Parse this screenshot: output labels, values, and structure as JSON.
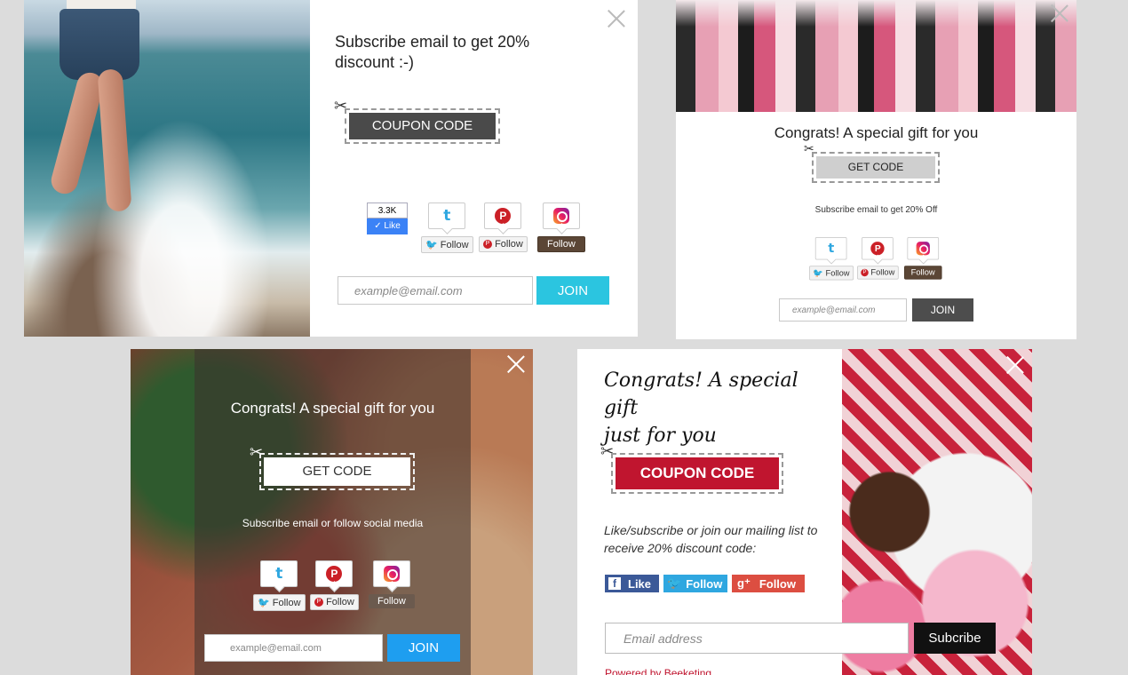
{
  "popup1": {
    "headline": "Subscribe email to get 20% discount :-)",
    "coupon_label": "COUPON CODE",
    "fb_count": "3.3K",
    "fb_like": "Like",
    "follow_label": "Follow",
    "email_placeholder": "example@email.com",
    "join_label": "JOIN"
  },
  "popup2": {
    "headline": "Congrats! A special gift for you",
    "coupon_label": "GET CODE",
    "subtext": "Subscribe email to get 20% Off",
    "follow_label": "Follow",
    "email_placeholder": "example@email.com",
    "join_label": "JOIN"
  },
  "popup3": {
    "headline": "Congrats! A special gift for you",
    "coupon_label": "GET CODE",
    "subtext": "Subscribe email or follow social media",
    "follow_label": "Follow",
    "email_placeholder": "example@email.com",
    "join_label": "JOIN"
  },
  "popup4": {
    "headline_line1": "Congrats! A special gift",
    "headline_line2": "just for you",
    "coupon_label": "COUPON CODE",
    "subtext_line1": "Like/subscribe or join our mailing list to",
    "subtext_line2": "receive 20% discount code:",
    "fb_label": "Like",
    "tw_label": "Follow",
    "gp_label": "Follow",
    "email_placeholder": "Email address",
    "subscribe_label": "Subcribe",
    "powered_by": "Powered by Beeketing"
  },
  "colors": {
    "dark_coupon": "#4a4a4a",
    "join_cyan": "#2bc5e0",
    "gray_join": "#4d4d4d",
    "join_blue": "#1e9ef0",
    "red_coupon": "#c0152f",
    "fb_blue": "#3b5998",
    "tw_blue": "#2fa7e0",
    "gp_red": "#dc4e41"
  }
}
